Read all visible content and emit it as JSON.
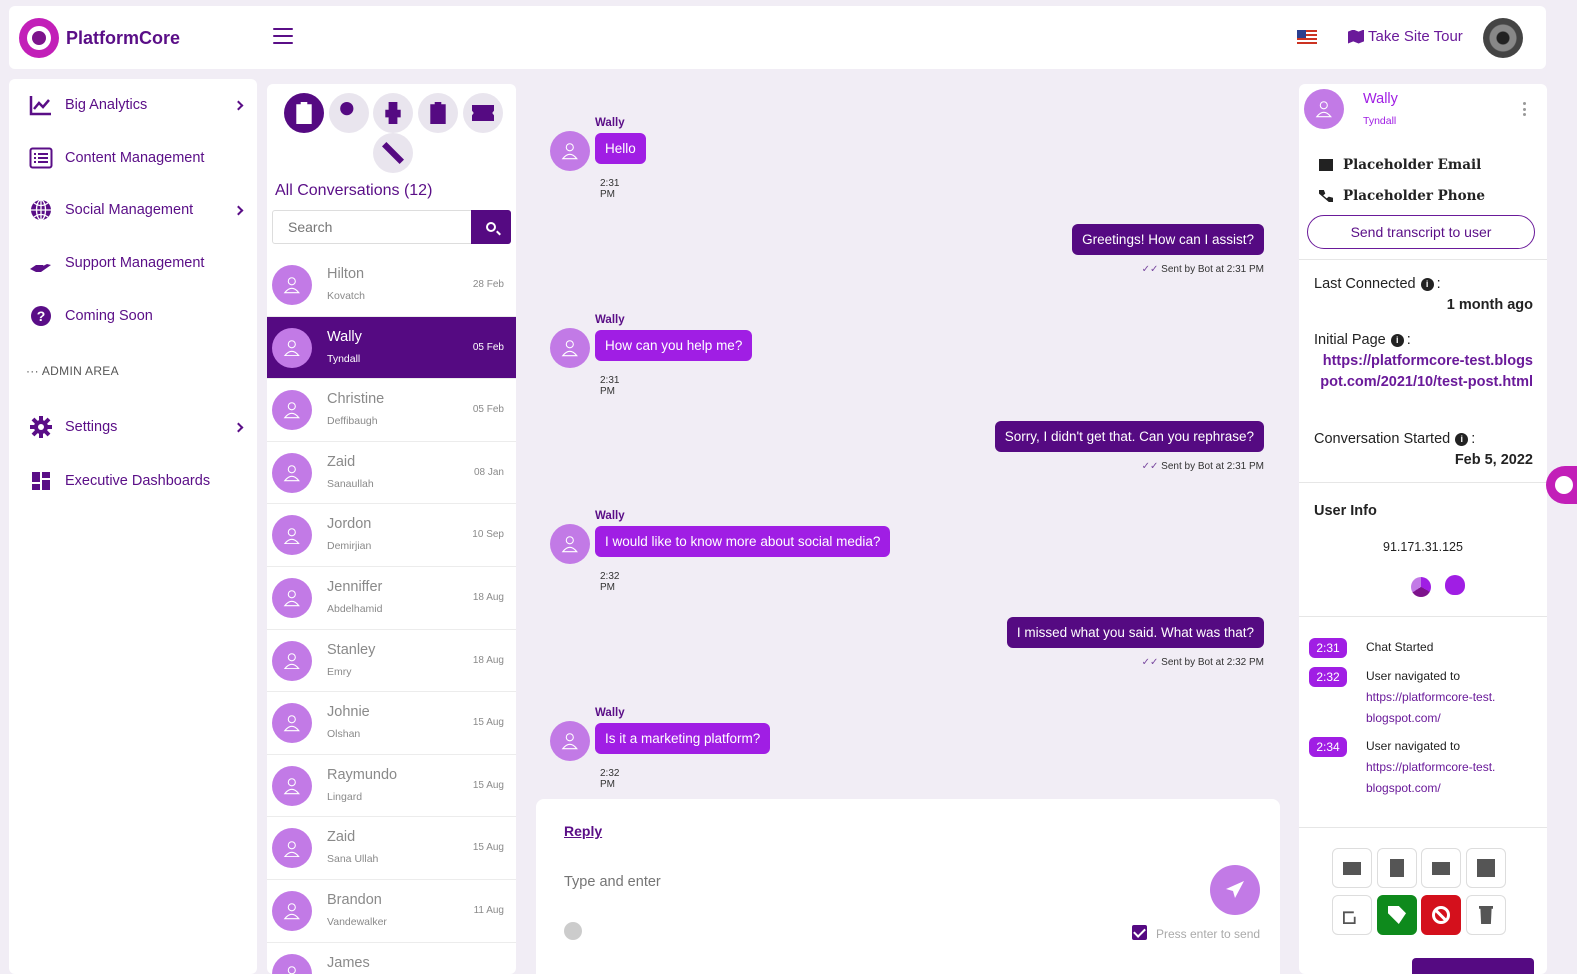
{
  "app": {
    "brand": "PlatformCore",
    "take_tour": "Take Site Tour",
    "colors": {
      "primary": "#550a82",
      "accent": "#a01ee4",
      "avatar": "#c27ae6",
      "brand": "#c21fb8"
    }
  },
  "sidebar": {
    "items": [
      {
        "label": "Big Analytics",
        "icon": "chart-line-icon",
        "has_children": true
      },
      {
        "label": "Content Management",
        "icon": "list-icon",
        "has_children": false
      },
      {
        "label": "Social Management",
        "icon": "globe-icon",
        "has_children": true
      },
      {
        "label": "Support Management",
        "icon": "hand-holding-icon",
        "has_children": false
      },
      {
        "label": "Coming Soon",
        "icon": "question-circle-icon",
        "has_children": false
      }
    ],
    "admin_label": "ADMIN AREA",
    "admin_items": [
      {
        "label": "Settings",
        "icon": "gear-icon",
        "has_children": true
      },
      {
        "label": "Executive Dashboards",
        "icon": "dashboard-icon",
        "has_children": false
      }
    ]
  },
  "conversations": {
    "filters": [
      "clipboard-list-icon",
      "user-tag-icon",
      "robot-icon",
      "clipboard-check-icon",
      "ticket-icon",
      "users-slash-icon"
    ],
    "title": "All Conversations (12)",
    "search_placeholder": "Search",
    "items": [
      {
        "first": "Hilton",
        "last": "Kovatch",
        "date": "28 Feb"
      },
      {
        "first": "Wally",
        "last": "Tyndall",
        "date": "05 Feb",
        "selected": true
      },
      {
        "first": "Christine",
        "last": "Deffibaugh",
        "date": "05 Feb"
      },
      {
        "first": "Zaid",
        "last": "Sanaullah",
        "date": "08 Jan"
      },
      {
        "first": "Jordon",
        "last": "Demirjian",
        "date": "10 Sep"
      },
      {
        "first": "Jenniffer",
        "last": "Abdelhamid",
        "date": "18 Aug"
      },
      {
        "first": "Stanley",
        "last": "Emry",
        "date": "18 Aug"
      },
      {
        "first": "Johnie",
        "last": "Olshan",
        "date": "15 Aug"
      },
      {
        "first": "Raymundo",
        "last": "Lingard",
        "date": "15 Aug"
      },
      {
        "first": "Zaid",
        "last": "Sana Ullah",
        "date": "15 Aug"
      },
      {
        "first": "Brandon",
        "last": "Vandewalker",
        "date": "11 Aug"
      },
      {
        "first": "James",
        "last": "",
        "date": ""
      }
    ]
  },
  "chat": {
    "messages": [
      {
        "dir": "in",
        "sender": "Wally",
        "text": "Hello",
        "time": "2:31 PM"
      },
      {
        "dir": "out",
        "text": "Greetings! How can I assist?",
        "meta": "Sent by Bot at 2:31 PM"
      },
      {
        "dir": "in",
        "sender": "Wally",
        "text": "How can you help me?",
        "time": "2:31 PM"
      },
      {
        "dir": "out",
        "text": "Sorry, I didn't get that. Can you rephrase?",
        "meta": "Sent by Bot at 2:31 PM"
      },
      {
        "dir": "in",
        "sender": "Wally",
        "text": "I would like to know more about social media?",
        "time": "2:32 PM"
      },
      {
        "dir": "out",
        "text": "I missed what you said. What was that?",
        "meta": "Sent by Bot at 2:32 PM"
      },
      {
        "dir": "in",
        "sender": "Wally",
        "text": "Is it a marketing platform?",
        "time": "2:32 PM"
      }
    ],
    "reply_tab": "Reply",
    "reply_placeholder": "Type and enter",
    "press_enter_label": "Press enter to send"
  },
  "details": {
    "name": "Wally",
    "last_name": "Tyndall",
    "email": "Placeholder Email",
    "phone": "Placeholder Phone",
    "transcript_button": "Send transcript to user",
    "last_connected_label": "Last Connected",
    "last_connected_value": "1 month ago",
    "initial_page_label": "Initial Page",
    "initial_page_value": "https://platformcore-test.blogspot.com/2021/10/test-post.html",
    "conversation_started_label": "Conversation Started",
    "conversation_started_value": "Feb 5, 2022",
    "user_info_label": "User Info",
    "ip": "91.171.31.125",
    "browser_icons": [
      "chrome-icon",
      "apple-icon"
    ],
    "timeline": [
      {
        "time": "2:31",
        "text": "Chat Started",
        "link": ""
      },
      {
        "time": "2:32",
        "text": "User navigated to",
        "link": "https://platformcore-test.blogspot.com/"
      },
      {
        "time": "2:34",
        "text": "User navigated to",
        "link": "https://platformcore-test.blogspot.com/"
      }
    ],
    "actions": [
      "ticket-icon",
      "clipboard-icon",
      "envelope-icon",
      "print-icon",
      "edit-icon",
      "tag-icon",
      "ban-icon",
      "trash-icon"
    ]
  }
}
